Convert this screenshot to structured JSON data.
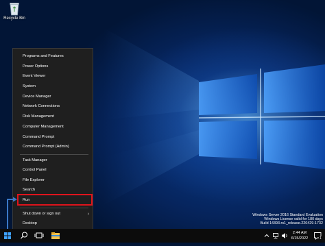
{
  "desktop": {
    "recycle_bin_label": "Recycle Bin",
    "watermark": {
      "line1": "Windows Server 2016 Standard Evaluation",
      "line2": "Windows License valid for 180 days",
      "line3": "Build 14393.rs1_release.220429-1732"
    }
  },
  "start_context_menu": {
    "items": [
      {
        "label": "Programs and Features"
      },
      {
        "label": "Power Options"
      },
      {
        "label": "Event Viewer"
      },
      {
        "label": "System"
      },
      {
        "label": "Device Manager"
      },
      {
        "label": "Network Connections"
      },
      {
        "label": "Disk Management"
      },
      {
        "label": "Computer Management"
      },
      {
        "label": "Command Prompt"
      },
      {
        "label": "Command Prompt (Admin)"
      },
      {
        "label": "Task Manager"
      },
      {
        "label": "Control Panel"
      },
      {
        "label": "File Explorer"
      },
      {
        "label": "Search"
      },
      {
        "label": "Run"
      },
      {
        "label": "Shut down or sign out",
        "submenu": true
      },
      {
        "label": "Desktop"
      }
    ],
    "highlighted_item": "Run"
  },
  "taskbar": {
    "clock": {
      "time": "2:44 AM",
      "date": "6/15/2022"
    },
    "icons": [
      "windows-start-icon",
      "search-icon",
      "task-view-icon",
      "file-explorer-icon",
      "chevron-up-icon",
      "network-icon",
      "volume-icon",
      "notification-icon"
    ],
    "notification_count": "1"
  },
  "colors": {
    "highlight": "#e0141c",
    "menu_background": "#1f1f1f",
    "taskbar_background": "#0c0c0c"
  }
}
